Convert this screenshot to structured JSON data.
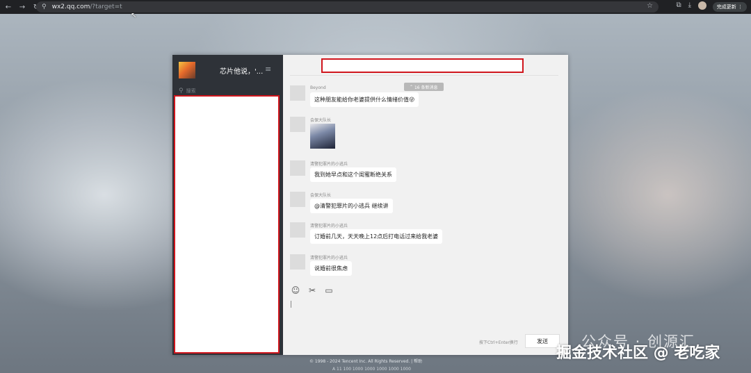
{
  "browser": {
    "url_host": "wx2.qq.com",
    "url_path": "/?target=t",
    "update_label": "完成更新"
  },
  "wechat": {
    "my_name": "芯片他说，'...",
    "search_placeholder": "搜索",
    "new_messages_badge": "16 条新消息",
    "messages": [
      {
        "sender": "Beyond",
        "text": "这种朋友能给你老婆提供什么情绪价值😜"
      },
      {
        "sender": "会保大队长",
        "image": true
      },
      {
        "sender": "清警犯罪片的小逃兵",
        "text": "我到她早点和这个闺蜜断绝关系"
      },
      {
        "sender": "会保大队长",
        "text": "@清警犯罪片的小逃兵 继续讲"
      },
      {
        "sender": "清警犯罪片的小逃兵",
        "text": "订婚前几天，天天晚上12点后打电话过来给我老婆"
      },
      {
        "sender": "清警犯罪片的小逃兵",
        "text": "说婚前很焦虑"
      }
    ],
    "input_hint": "按下Ctrl+Enter换行",
    "send_label": "发送"
  },
  "footer": {
    "line1": "© 1998 - 2024 Tencent Inc. All Rights Reserved.  |  帮助",
    "line2": "A 11 100 1000 1000 1000 1000 1000"
  },
  "watermark": {
    "line1": "公众号 · 创源汇",
    "line2": "掘金技术社区 @ 老吃家"
  },
  "icons": {
    "emoji": "smile-icon",
    "scissors": "scissors-icon",
    "folder": "folder-icon"
  }
}
